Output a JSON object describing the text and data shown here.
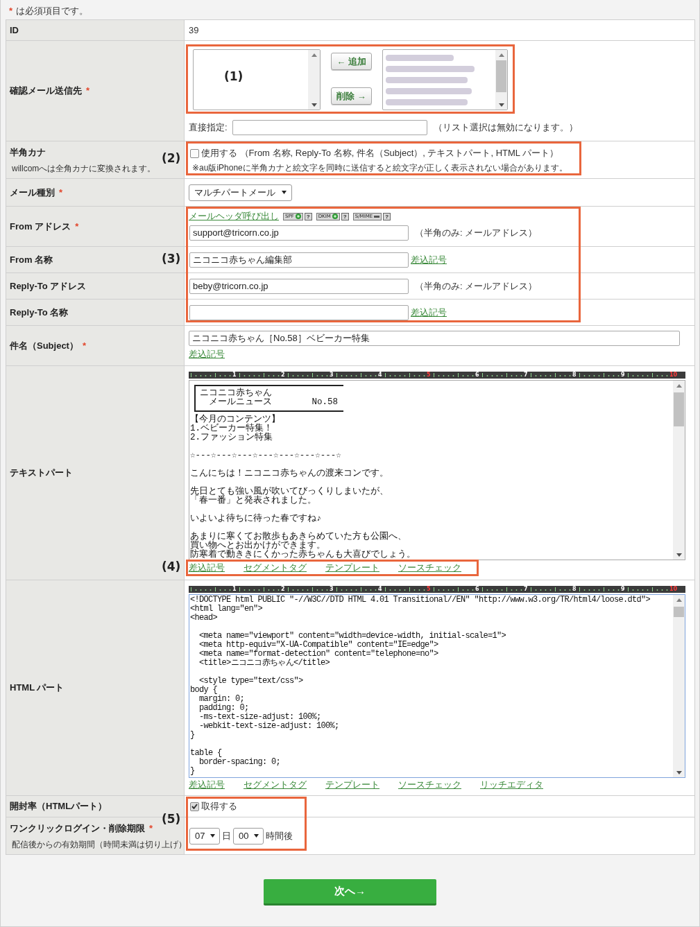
{
  "required_note": {
    "mark": "*",
    "text": "は必須項目です。"
  },
  "rows": [
    {
      "kind": "static",
      "label": "ID",
      "value": "39"
    },
    {
      "kind": "recipients",
      "label": "確認メール送信先",
      "required_mark": "*",
      "add_button": "← 追加",
      "remove_button": "削除 →",
      "direct_label": "直接指定:",
      "direct_note": "（リスト選択は無効になります。）"
    },
    {
      "kind": "checkbox",
      "label": "半角カナ",
      "sublabel": "willcomへは全角カナに変換されます。",
      "checked": false,
      "text": "使用する （From 名称, Reply-To 名称, 件名（Subject）, テキストパート, HTML パート）",
      "note": "※au版iPhoneに半角カナと絵文字を同時に送信すると絵文字が正しく表示されない場合があります。"
    },
    {
      "kind": "select",
      "label": "メール種別",
      "required_mark": "*",
      "value": "マルチパートメール"
    },
    {
      "kind": "field",
      "label": "From アドレス",
      "required_mark": "*",
      "header_link": "メールヘッダ呼び出し",
      "badges": [
        {
          "label": "SPF",
          "active": true,
          "help": "?"
        },
        {
          "label": "DKIM",
          "active": true,
          "help": "?"
        },
        {
          "label": "S/MIME",
          "active": false,
          "help": "?"
        }
      ],
      "value": "support@tricorn.co.jp",
      "hint": "（半角のみ: メールアドレス）"
    },
    {
      "kind": "field",
      "label": "From 名称",
      "value": "ニコニコ赤ちゃん編集部",
      "link": "差込記号"
    },
    {
      "kind": "field",
      "label": "Reply-To アドレス",
      "value": "beby@tricorn.co.jp",
      "hint": "（半角のみ: メールアドレス）"
    },
    {
      "kind": "field",
      "label": "Reply-To 名称",
      "link": "差込記号"
    },
    {
      "kind": "subject",
      "label": "件名（Subject）",
      "required_mark": "*",
      "value": "ニコニコ赤ちゃん［No.58］ベビーカー特集",
      "link": "差込記号"
    },
    {
      "kind": "editor",
      "label": "テキストパート",
      "focused": false,
      "ruler": [
        {
          "label": "1",
          "highlight": false
        },
        {
          "label": "2",
          "highlight": false
        },
        {
          "label": "3",
          "highlight": false
        },
        {
          "label": "4",
          "highlight": false
        },
        {
          "label": "5",
          "highlight": true
        },
        {
          "label": "6",
          "highlight": false
        },
        {
          "label": "7",
          "highlight": false
        },
        {
          "label": "8",
          "highlight": false
        },
        {
          "label": "9",
          "highlight": false
        },
        {
          "label": "10",
          "highlight": true
        }
      ],
      "heading_box": {
        "title": "ニコニコ赤ちゃん",
        "subtitle": "メールニュース",
        "number": "No.58"
      },
      "paragraphs": [
        [
          "【今月のコンテンツ】",
          "1.ベビーカー特集！",
          "2.ファッション特集"
        ],
        [
          "☆---☆---☆---☆---☆---☆---☆---☆"
        ],
        [
          "こんにちは！ニコニコ赤ちゃんの渡来コンです。"
        ],
        [
          "先日とても強い風が吹いてびっくりしまいたが、",
          "「春一番」と発表されました。"
        ],
        [
          "いよいよ待ちに待った春ですね♪"
        ],
        [
          "あまりに寒くてお散歩もあきらめていた方も公園へ、",
          "買い物へとお出かけができます。",
          "防寒着で動ききにくかった赤ちゃんも大喜びでしょう。"
        ]
      ],
      "links": [
        "差込記号",
        "セグメントタグ",
        "テンプレート",
        "ソースチェック"
      ]
    },
    {
      "kind": "editor",
      "label": "HTML パート",
      "focused": true,
      "ruler": [
        {
          "label": "1",
          "highlight": false
        },
        {
          "label": "2",
          "highlight": false
        },
        {
          "label": "3",
          "highlight": false
        },
        {
          "label": "4",
          "highlight": false
        },
        {
          "label": "5",
          "highlight": true
        },
        {
          "label": "6",
          "highlight": false
        },
        {
          "label": "7",
          "highlight": false
        },
        {
          "label": "8",
          "highlight": false
        },
        {
          "label": "9",
          "highlight": false
        },
        {
          "label": "10",
          "highlight": true
        }
      ],
      "paragraphs": [
        [
          "<!DOCTYPE html PUBLIC \"-//W3C//DTD HTML 4.01 Transitional//EN\" \"http://www.w3.org/TR/html4/loose.dtd\">",
          "<html lang=\"en\">",
          "<head>"
        ],
        [
          "  <meta name=\"viewport\" content=\"width=device-width, initial-scale=1\">",
          "  <meta http-equiv=\"X-UA-Compatible\" content=\"IE=edge\">",
          "  <meta name=\"format-detection\" content=\"telephone=no\">",
          "  <title>ニコニコ赤ちゃん</title>"
        ],
        [
          "  <style type=\"text/css\">",
          "body {",
          "  margin: 0;",
          "  padding: 0;",
          "  -ms-text-size-adjust: 100%;",
          "  -webkit-text-size-adjust: 100%;",
          "}"
        ],
        [
          "table {",
          "  border-spacing: 0;",
          "}"
        ]
      ],
      "links": [
        "差込記号",
        "セグメントタグ",
        "テンプレート",
        "ソースチェック",
        "リッチエディタ"
      ]
    },
    {
      "kind": "checkbox",
      "label": "開封率（HTMLパート）",
      "checked": true,
      "text": "取得する"
    },
    {
      "kind": "expiry",
      "label": "ワンクリックログイン・削除期限",
      "required_mark": "*",
      "sublabel": "配信後からの有効期間（時間未満は切り上げ）",
      "days": "07",
      "day_unit": "日",
      "hours": "00",
      "hour_unit": "時間後"
    }
  ],
  "annotations": [
    {
      "label": "(1)"
    },
    {
      "label": "(2)"
    },
    {
      "label": "(3)"
    },
    {
      "label": "(4)"
    },
    {
      "label": "(5)"
    }
  ],
  "next_button": "次へ→"
}
